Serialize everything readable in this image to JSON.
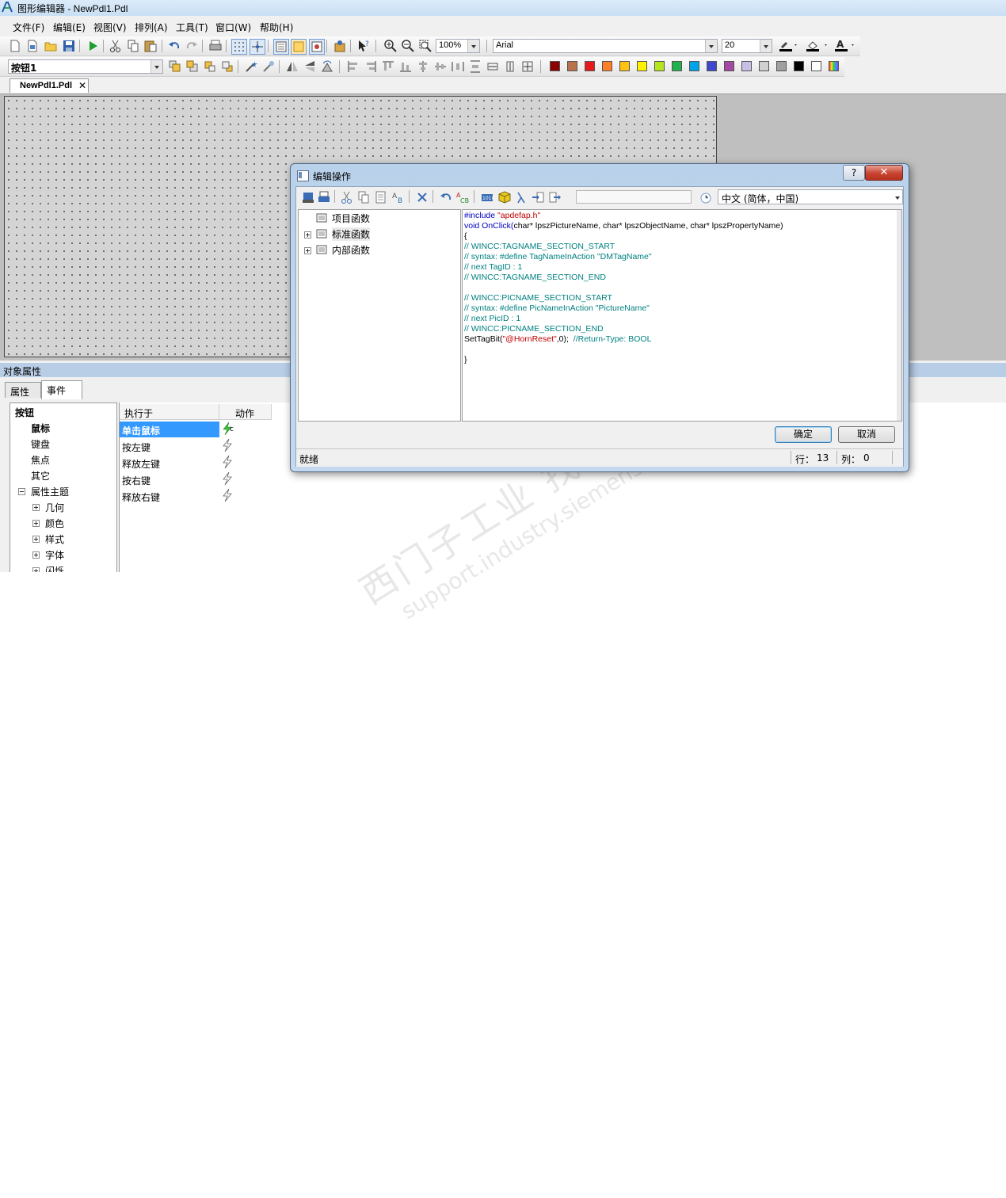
{
  "window": {
    "title": "图形编辑器 - NewPdl1.Pdl"
  },
  "menu": [
    "文件(F)",
    "编辑(E)",
    "视图(V)",
    "排列(A)",
    "工具(T)",
    "窗口(W)",
    "帮助(H)"
  ],
  "toolbar": {
    "zoom": "100%",
    "font_name": "Arial",
    "font_size": "20",
    "object_selector": "按钮1",
    "palette": [
      "#8b0000",
      "#b8734c",
      "#e61a1a",
      "#ff7f27",
      "#ffc20e",
      "#fff200",
      "#b5e61d",
      "#22b14c",
      "#00a2e8",
      "#3f48cc",
      "#a349a4",
      "#c8bfe7",
      "#d0d0d0",
      "#a0a0a0",
      "#000000",
      "#ffffff"
    ]
  },
  "document_tab": {
    "label": "NewPdl1.Pdl",
    "close": "✕"
  },
  "properties": {
    "title": "对象属性",
    "tabs": [
      "属性",
      "事件"
    ],
    "tree": {
      "root": "按钮",
      "items": [
        "鼠标",
        "键盘",
        "焦点",
        "其它"
      ],
      "group": "属性主题",
      "group_items": [
        "几何",
        "颜色",
        "样式",
        "字体",
        "闪烁"
      ]
    },
    "columns": [
      "执行于",
      "动作"
    ],
    "events": [
      "单击鼠标",
      "按左键",
      "释放左键",
      "按右键",
      "释放右键"
    ],
    "first_action_marker": "c"
  },
  "dialog": {
    "title": "编辑操作",
    "help": "?",
    "close": "✕",
    "language": "中文 (简体，中国)",
    "functions": [
      "项目函数",
      "标准函数",
      "内部函数"
    ],
    "code": [
      {
        "t": "#include ",
        "c": "inc",
        "t2": "\"apdefap.h\"",
        "c2": "str"
      },
      {
        "t": "void OnClick(",
        "c": "kw",
        "t2": "char* lpszPictureName, char* lpszObjectName, char* lpszPropertyName)",
        "c2": ""
      },
      {
        "t": "{",
        "c": ""
      },
      {
        "t": "// WINCC:TAGNAME_SECTION_START",
        "c": "com"
      },
      {
        "t": "// syntax: #define TagNameInAction \"DMTagName\"",
        "c": "com"
      },
      {
        "t": "// next TagID : 1",
        "c": "com"
      },
      {
        "t": "// WINCC:TAGNAME_SECTION_END",
        "c": "com"
      },
      {
        "t": "",
        "c": ""
      },
      {
        "t": "// WINCC:PICNAME_SECTION_START",
        "c": "com"
      },
      {
        "t": "// syntax: #define PicNameInAction \"PictureName\"",
        "c": "com"
      },
      {
        "t": "// next PicID : 1",
        "c": "com"
      },
      {
        "t": "// WINCC:PICNAME_SECTION_END",
        "c": "com"
      },
      {
        "t": "SetTagBit(",
        "c": "",
        "t2": "\"@HornReset\"",
        "c2": "str",
        "t3": ",0);  ",
        "c3": "",
        "t4": "//Return-Type: BOOL",
        "c4": "com"
      },
      {
        "t": "",
        "c": ""
      },
      {
        "t": "}",
        "c": ""
      }
    ],
    "ok": "确定",
    "cancel": "取消",
    "status": "就绪",
    "row_label": "行：",
    "row": "13",
    "col_label": "列：",
    "col": "0"
  },
  "watermark": {
    "line1": "西门子工业  找答案",
    "line2": "support.industry.siemens.com/cs"
  }
}
